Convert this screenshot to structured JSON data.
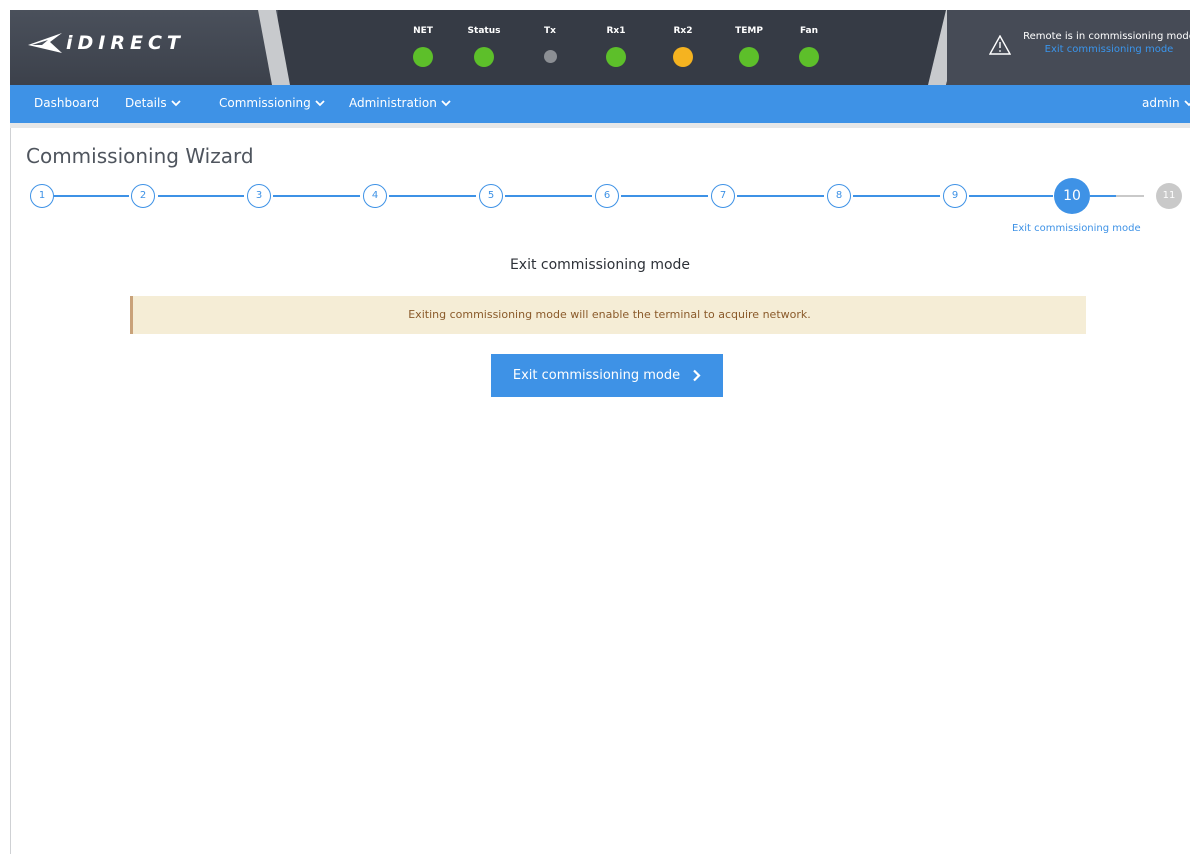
{
  "header": {
    "logo_text": "iDIRECT",
    "status": [
      {
        "label": "NET",
        "color": "#5dbf2a"
      },
      {
        "label": "Status",
        "color": "#5dbf2a"
      },
      {
        "label": "Tx",
        "color": "#8c8f94"
      },
      {
        "label": "Rx1",
        "color": "#5dbf2a"
      },
      {
        "label": "Rx2",
        "color": "#f5b320"
      },
      {
        "label": "TEMP",
        "color": "#5dbf2a"
      },
      {
        "label": "Fan",
        "color": "#5dbf2a"
      }
    ],
    "remote_text": "Remote is in commissioning mode",
    "remote_link": "Exit commissioning mode"
  },
  "nav": {
    "items": [
      {
        "label": "Dashboard",
        "dropdown": false
      },
      {
        "label": "Details",
        "dropdown": true
      },
      {
        "label": "Commissioning",
        "dropdown": true
      },
      {
        "label": "Administration",
        "dropdown": true
      }
    ],
    "user": "admin"
  },
  "page": {
    "title": "Commissioning Wizard",
    "steps": [
      "1",
      "2",
      "3",
      "4",
      "5",
      "6",
      "7",
      "8",
      "9",
      "10",
      "11"
    ],
    "active_step": "10",
    "active_step_caption": "Exit commissioning mode",
    "section_heading": "Exit commissioning mode",
    "alert_text": "Exiting commissioning mode will enable the terminal to acquire network.",
    "button_label": "Exit commissioning mode"
  },
  "colors": {
    "accent": "#3e92e6",
    "header_bg": "#363b45",
    "alert_bg": "#f5edd6",
    "alert_text": "#8a5a2a",
    "disabled_step": "#c9c9c9"
  }
}
